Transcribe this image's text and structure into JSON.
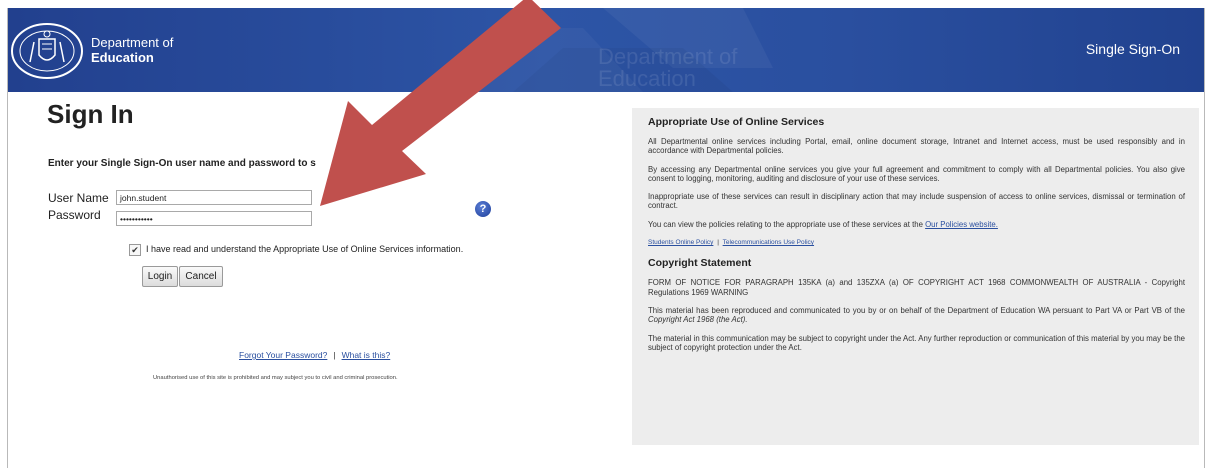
{
  "header": {
    "crest_text": "THE GOVERNMENT OF WESTERN AUSTRALIA",
    "dept_line1": "Department of",
    "dept_line2": "Education",
    "watermark_line1": "Department of",
    "watermark_line2": "Education",
    "app_title": "Single Sign-On"
  },
  "signin": {
    "title": "Sign In",
    "instruction": "Enter your Single Sign-On user name and password to s",
    "username_label": "User Name",
    "username_value": "john.student",
    "password_label": "Password",
    "password_value": "•••••••••••",
    "help_icon": "question-circle",
    "checkbox_checked": true,
    "checkbox_label": "I have read and understand the Appropriate Use of Online Services information.",
    "login_label": "Login",
    "cancel_label": "Cancel",
    "forgot_link": "Forgot Your Password?",
    "link_separator": "|",
    "what_link": "What is this?",
    "disclaimer": "Unauthorised use of this site is prohibited and may subject you to civil and criminal prosecution."
  },
  "info_panel": {
    "use_heading": "Appropriate Use of Online Services",
    "para1": "All Departmental online services including Portal, email, online document storage, Intranet and Internet access, must be used responsibly and in accordance with Departmental policies.",
    "para2": "By accessing any Departmental online services you give your full agreement and commitment to comply with all Departmental policies. You also give consent to logging, monitoring, auditing and disclosure of your use of these services.",
    "para3": "Inappropriate use of these services can result in disciplinary action that may include suspension of access to online services, dismissal or termination of contract.",
    "para4_text": "You can view the policies relating to the appropriate use of these services at the",
    "para4_link": "Our Policies website.",
    "students_policy_link": "Students Online Policy",
    "policy_separator": "|",
    "telecom_policy_link": "Telecommunications Use Policy",
    "copyright_heading": "Copyright Statement",
    "copy_para1": "FORM OF NOTICE FOR PARAGRAPH 135KA (a) and 135ZXA (a) OF COPYRIGHT ACT 1968 COMMONWEALTH OF AUSTRALIA - Copyright Regulations 1969 WARNING",
    "copy_para2_text": "This material has been reproduced and communicated to you by or on behalf of the Department of Education WA persuant to Part VA or Part VB of the",
    "copy_para2_italic": "Copyright Act 1968 (the Act).",
    "copy_para3": "The material in this communication may be subject to copyright under the Act. Any further reproduction or communication of this material by you may be the subject of copyright protection under the Act."
  },
  "colors": {
    "header_blue": "#2a4f9f",
    "arrow_red": "#c0504d",
    "panel_grey": "#ededed",
    "link_blue": "#2a4f9f"
  }
}
